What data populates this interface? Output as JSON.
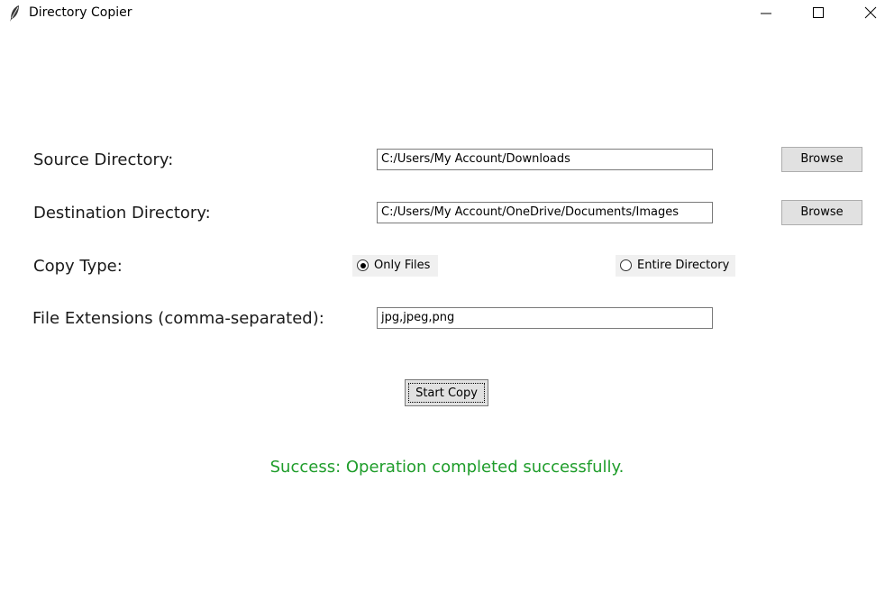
{
  "window": {
    "title": "Directory Copier",
    "icon": "feather-icon",
    "controls": [
      "minimize-icon",
      "maximize-icon",
      "close-icon"
    ]
  },
  "form": {
    "source": {
      "label": "Source Directory:",
      "value": "C:/Users/My Account/Downloads",
      "browse_label": "Browse"
    },
    "destination": {
      "label": "Destination Directory:",
      "value": "C:/Users/My Account/OneDrive/Documents/Images",
      "browse_label": "Browse"
    },
    "copy_type": {
      "label": "Copy Type:",
      "options": [
        {
          "label": "Only Files",
          "selected": true
        },
        {
          "label": "Entire Directory",
          "selected": false
        }
      ]
    },
    "extensions": {
      "label": "File Extensions (comma-separated):",
      "value": "jpg,jpeg,png"
    },
    "start_label": "Start Copy"
  },
  "status": {
    "message": "Success: Operation completed successfully.",
    "color": "#1f9d2b"
  }
}
